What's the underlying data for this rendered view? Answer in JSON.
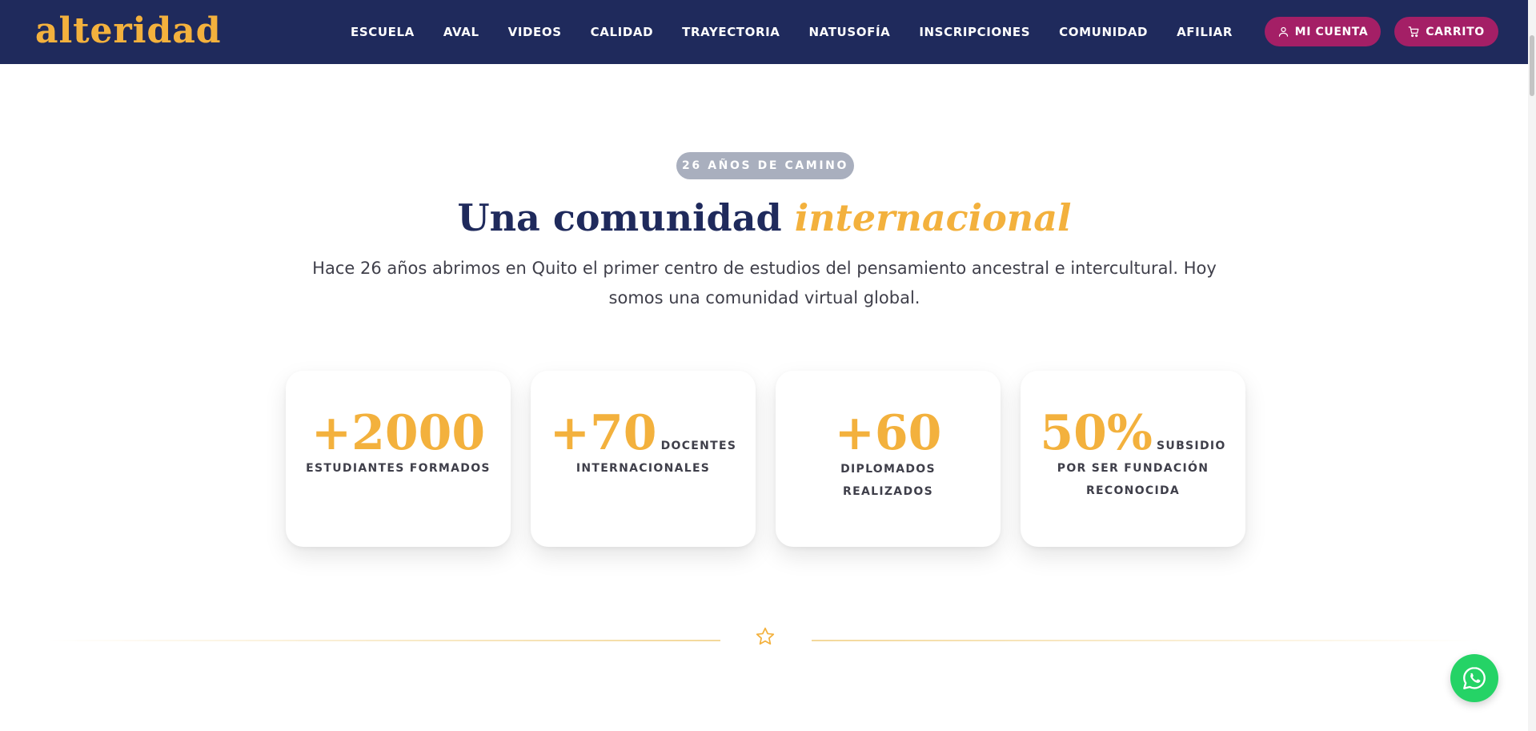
{
  "header": {
    "logo_text": "alteridad",
    "nav": [
      "ESCUELA",
      "AVAL",
      "VIDEOS",
      "CALIDAD",
      "TRAYECTORIA",
      "NATUSOFÍA",
      "INSCRIPCIONES",
      "COMUNIDAD",
      "AFILIAR"
    ],
    "account_label": "MI CUENTA",
    "cart_label": "CARRITO"
  },
  "hero": {
    "badge": "26 AÑOS DE CAMINO",
    "title_main": "Una comunidad ",
    "title_accent": "internacional",
    "subtitle": "Hace 26 años abrimos en Quito el primer centro de estudios del pensamiento ancestral e intercultural. Hoy somos una comunidad virtual global."
  },
  "stats": [
    {
      "number": "+2000",
      "label_inline": "",
      "label_below": "ESTUDIANTES FORMADOS"
    },
    {
      "number": "+70",
      "label_inline": "DOCENTES",
      "label_below": "INTERNACIONALES"
    },
    {
      "number": "+60",
      "label_inline": "DIPLOMADOS",
      "label_below": "REALIZADOS"
    },
    {
      "number": "50%",
      "label_inline": "SUBSIDIO",
      "label_below": "POR SER FUNDACIÓN RECONOCIDA"
    }
  ],
  "colors": {
    "navy": "#1f2a5c",
    "gold": "#f3b13d",
    "magenta": "#a41f66",
    "whatsapp_green": "#25d366"
  },
  "icons": {
    "account": "user-icon",
    "cart": "cart-icon",
    "divider": "star-icon",
    "chat": "whatsapp-icon"
  }
}
